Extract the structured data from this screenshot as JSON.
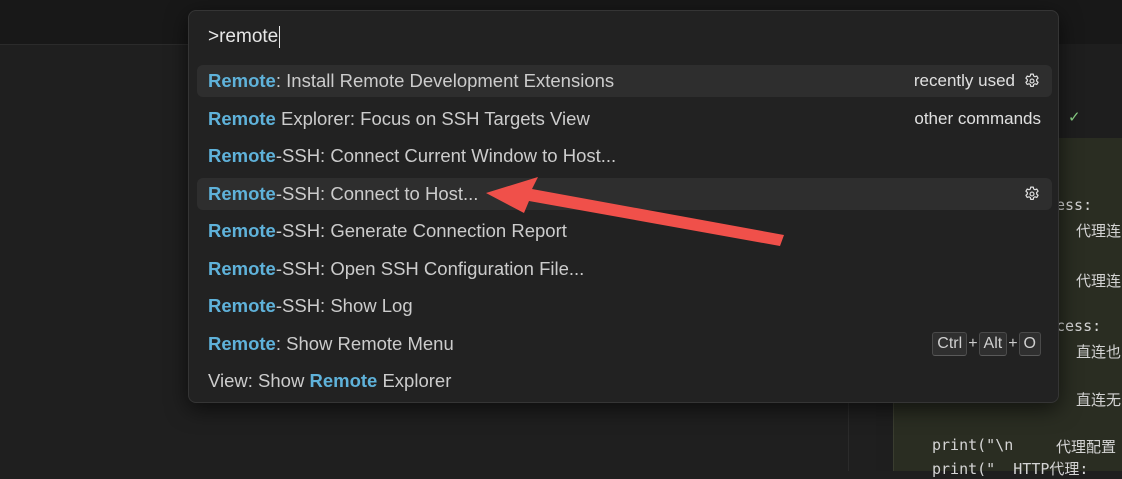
{
  "search": {
    "value": ">remote"
  },
  "items": [
    {
      "pre": "",
      "bold": "Remote",
      "post": ": Install Remote Development Extensions",
      "tag": "recently used",
      "gear": true,
      "highlight": true
    },
    {
      "pre": "",
      "bold": "Remote",
      "post": " Explorer: Focus on SSH Targets View",
      "tag": "other commands",
      "gear": false
    },
    {
      "pre": "",
      "bold": "Remote",
      "post": "-SSH: Connect Current Window to Host...",
      "tag": "",
      "gear": false
    },
    {
      "pre": "",
      "bold": "Remote",
      "post": "-SSH: Connect to Host...",
      "tag": "",
      "gear": true,
      "highlight": true
    },
    {
      "pre": "",
      "bold": "Remote",
      "post": "-SSH: Generate Connection Report",
      "tag": "",
      "gear": false
    },
    {
      "pre": "",
      "bold": "Remote",
      "post": "-SSH: Open SSH Configuration File...",
      "tag": "",
      "gear": false
    },
    {
      "pre": "",
      "bold": "Remote",
      "post": "-SSH: Show Log",
      "tag": "",
      "gear": false
    },
    {
      "pre": "",
      "bold": "Remote",
      "post": ": Show Remote Menu",
      "tag": "",
      "gear": false,
      "keys": [
        "Ctrl",
        "Alt",
        "O"
      ]
    },
    {
      "pre": "View: Show ",
      "bold": "Remote",
      "post": " Explorer",
      "tag": "",
      "gear": false
    }
  ],
  "shortcut_separator": "+",
  "editor": {
    "lines": [
      {
        "text": "ess:",
        "kind": "plain"
      },
      {
        "text": "代理连",
        "kind": "cjk"
      },
      {
        "text": "代理连",
        "kind": "cjk"
      },
      {
        "text": "cess:",
        "kind": "plain"
      },
      {
        "text": "直连也",
        "kind": "cjk"
      },
      {
        "text": "直连无",
        "kind": "cjk"
      },
      {
        "text": "print(\"\\n",
        "kind": "fn"
      },
      {
        "text": "代理配置",
        "kind": "cjk"
      },
      {
        "text": "print(\"  HTTP代理:",
        "kind": "fn"
      }
    ],
    "check": "✓"
  },
  "colors": {
    "accent": "#5fb2da",
    "arrow": "#f0504a",
    "highlight": "#2e2e2e"
  }
}
